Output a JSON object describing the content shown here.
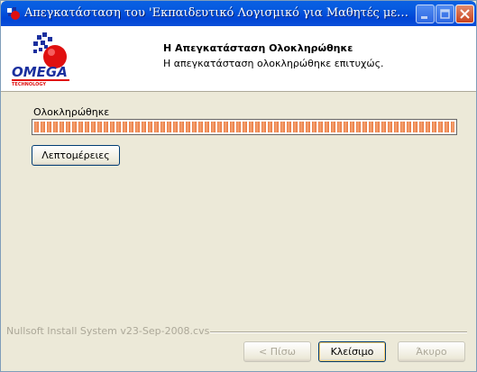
{
  "window": {
    "title": "Απεγκατάσταση του 'Εκπαιδευτικό Λογισμικό για Μαθητές με Κι...",
    "controls": [
      "minimize-icon",
      "maximize-icon",
      "close-icon"
    ]
  },
  "header": {
    "title": "Η Απεγκατάσταση Ολοκληρώθηκε",
    "subtitle": "Η απεγκατάσταση ολοκληρώθηκε επιτυχώς.",
    "logo_text": "OMEGA",
    "logo_subtext": "TECHNOLOGY"
  },
  "body": {
    "status_label": "Ολοκληρώθηκε",
    "progress": 1.0,
    "details_button": "Λεπτομέρειες"
  },
  "footer": {
    "branding": "Nullsoft Install System v23-Sep-2008.cvs",
    "back_button": "< Πίσω",
    "close_button": "Κλείσιμο",
    "cancel_button": "Άκυρο"
  },
  "colors": {
    "titlebar": "#0054e3",
    "progress": "#e7743c",
    "logo_red": "#e01010",
    "logo_blue": "#1a2f9e"
  }
}
